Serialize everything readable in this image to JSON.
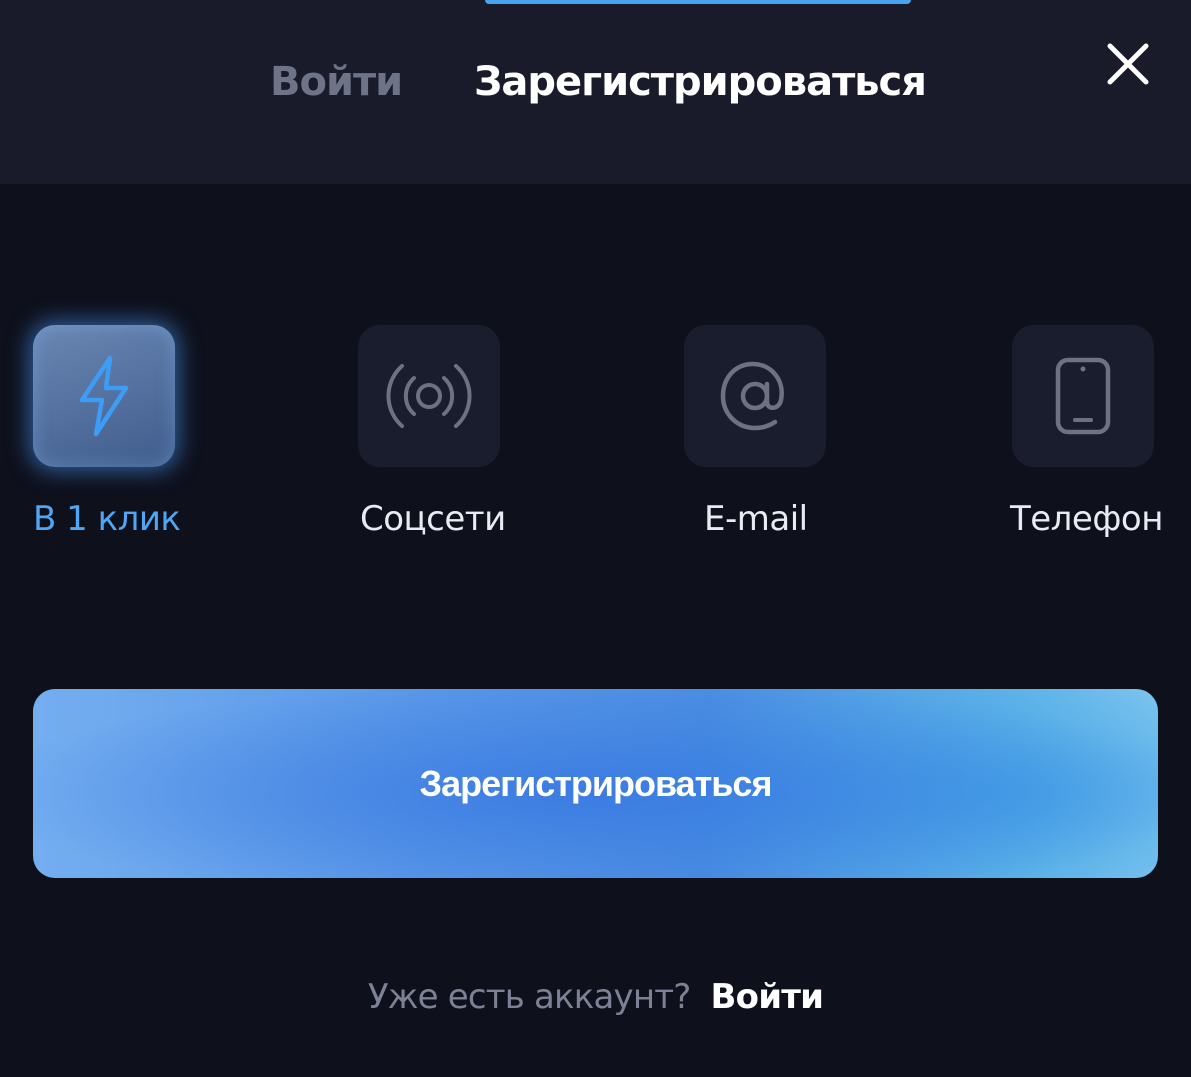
{
  "header": {
    "tabs": [
      {
        "label": "Войти",
        "active": false
      },
      {
        "label": "Зарегистрироваться",
        "active": true
      }
    ],
    "close_icon": "close-icon"
  },
  "methods": [
    {
      "label": "В 1 клик",
      "icon": "lightning-icon",
      "active": true
    },
    {
      "label": "Соцсети",
      "icon": "broadcast-icon",
      "active": false
    },
    {
      "label": "E-mail",
      "icon": "at-sign-icon",
      "active": false
    },
    {
      "label": "Телефон",
      "icon": "phone-icon",
      "active": false
    }
  ],
  "submit": {
    "label": "Зарегистрироваться"
  },
  "footer": {
    "question": "Уже есть аккаунт?",
    "link": "Войти"
  },
  "colors": {
    "background": "#0e101c",
    "header": "#191b2b",
    "accent": "#4ea6f4",
    "tile": "#1a1d2e",
    "muted_text": "#7d8196"
  }
}
